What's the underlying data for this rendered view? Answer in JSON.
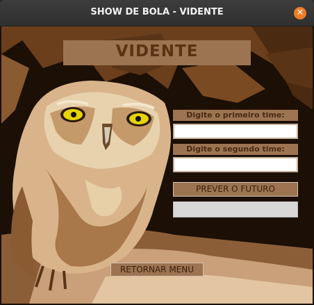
{
  "window": {
    "title": "SHOW DE BOLA - VIDENTE",
    "close_icon": "close-icon",
    "close_glyph": "✕"
  },
  "main": {
    "heading": "VIDENTE",
    "background_image": "owl-photo",
    "first_team_label": "Digite o primeiro time:",
    "first_team_value": "",
    "second_team_label": "Digite o segundo time:",
    "second_team_value": "",
    "predict_button": "PREVER O FUTURO",
    "result_text": "",
    "back_button": "RETORNAR MENU"
  },
  "colors": {
    "panel_brown": "#9c7452",
    "heading_text": "#5a3312",
    "close_orange": "#f07b25",
    "result_gray": "#d8d8d8"
  }
}
